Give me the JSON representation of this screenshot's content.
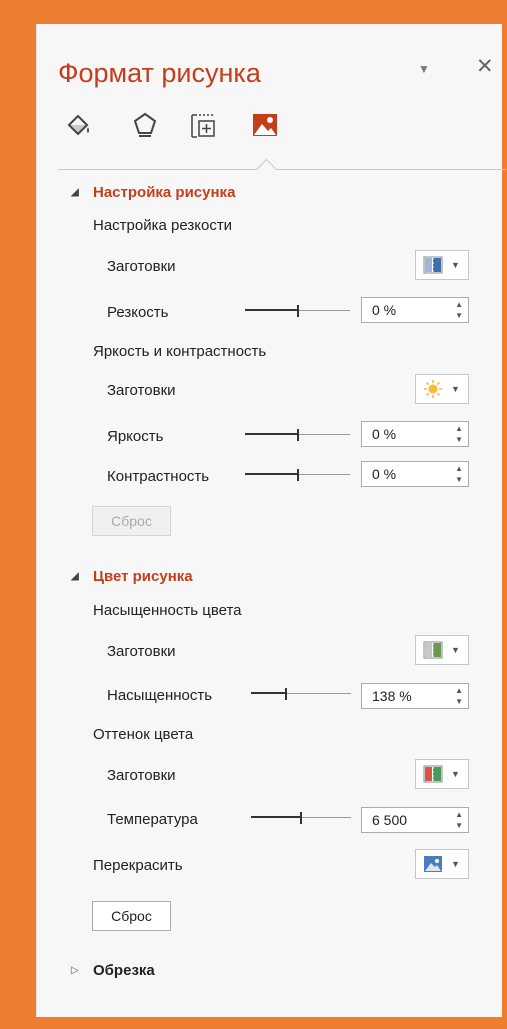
{
  "pane": {
    "title": "Формат рисунка",
    "tabs": [
      {
        "name": "fill-line-icon"
      },
      {
        "name": "effects-icon"
      },
      {
        "name": "size-properties-icon"
      },
      {
        "name": "picture-icon",
        "active": true
      }
    ]
  },
  "picture_corrections": {
    "header": "Настройка рисунка",
    "sharpen": {
      "title": "Настройка резкости",
      "presets_label": "Заготовки",
      "sharpness_label": "Резкость",
      "sharpness_value": "0 %",
      "sharpness_level": 0.5
    },
    "brightness_contrast": {
      "title": "Яркость и контрастность",
      "presets_label": "Заготовки",
      "brightness_label": "Яркость",
      "brightness_value": "0 %",
      "brightness_level": 0.5,
      "contrast_label": "Контрастность",
      "contrast_value": "0 %",
      "contrast_level": 0.5
    },
    "reset_label": "Сброс"
  },
  "picture_color": {
    "header": "Цвет рисунка",
    "saturation": {
      "title": "Насыщенность цвета",
      "presets_label": "Заготовки",
      "saturation_label": "Насыщенность",
      "saturation_value": "138 %",
      "saturation_level": 0.35
    },
    "tone": {
      "title": "Оттенок цвета",
      "presets_label": "Заготовки",
      "temperature_label": "Температура",
      "temperature_value": "6 500",
      "temperature_level": 0.5
    },
    "recolor_label": "Перекрасить",
    "reset_label": "Сброс"
  },
  "crop": {
    "header": "Обрезка"
  },
  "colors": {
    "accent": "#C43E1C",
    "frame": "#ED7D31"
  }
}
